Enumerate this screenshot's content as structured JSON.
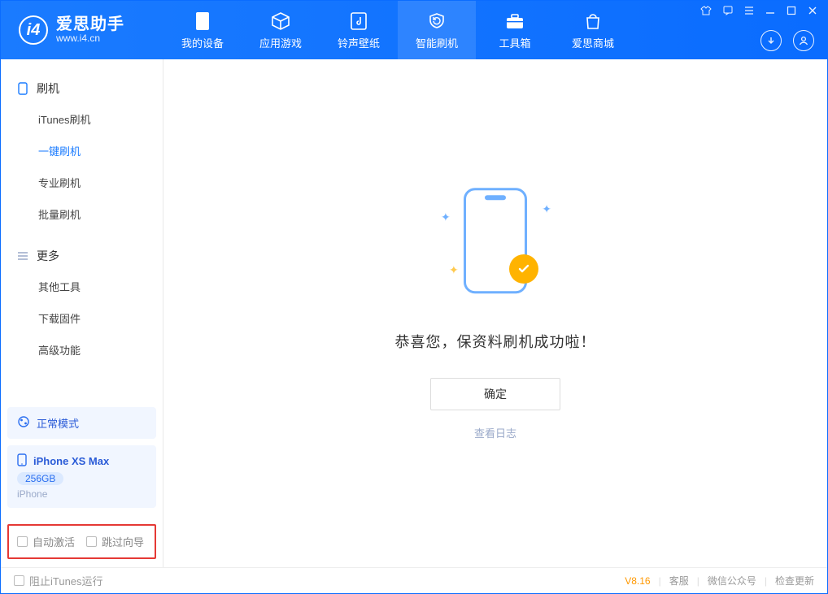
{
  "app": {
    "title": "爱思助手",
    "subtitle": "www.i4.cn"
  },
  "nav": {
    "items": [
      {
        "label": "我的设备"
      },
      {
        "label": "应用游戏"
      },
      {
        "label": "铃声壁纸"
      },
      {
        "label": "智能刷机"
      },
      {
        "label": "工具箱"
      },
      {
        "label": "爱思商城"
      }
    ]
  },
  "sidebar": {
    "group1": {
      "title": "刷机",
      "items": [
        {
          "label": "iTunes刷机"
        },
        {
          "label": "一键刷机"
        },
        {
          "label": "专业刷机"
        },
        {
          "label": "批量刷机"
        }
      ]
    },
    "group2": {
      "title": "更多",
      "items": [
        {
          "label": "其他工具"
        },
        {
          "label": "下载固件"
        },
        {
          "label": "高级功能"
        }
      ]
    }
  },
  "device": {
    "mode_label": "正常模式",
    "name": "iPhone XS Max",
    "capacity": "256GB",
    "type": "iPhone"
  },
  "options": {
    "auto_activate": "自动激活",
    "skip_guide": "跳过向导"
  },
  "main": {
    "success_text": "恭喜您，保资料刷机成功啦！",
    "confirm": "确定",
    "view_log": "查看日志"
  },
  "footer": {
    "block_itunes": "阻止iTunes运行",
    "version": "V8.16",
    "support": "客服",
    "wechat": "微信公众号",
    "check_update": "检查更新"
  }
}
